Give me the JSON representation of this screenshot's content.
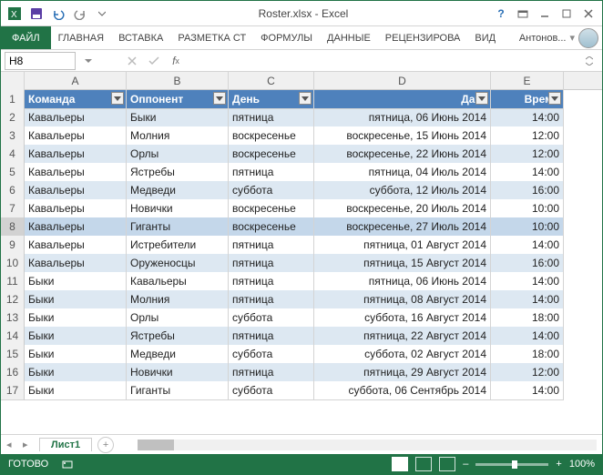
{
  "window": {
    "title": "Roster.xlsx - Excel",
    "user": "Антонов..."
  },
  "ribbon": {
    "file": "ФАЙЛ",
    "tabs": [
      "ГЛАВНАЯ",
      "ВСТАВКА",
      "РАЗМЕТКА СТ",
      "ФОРМУЛЫ",
      "ДАННЫЕ",
      "РЕЦЕНЗИРОВА",
      "ВИД"
    ]
  },
  "namebox": "H8",
  "columns": [
    "A",
    "B",
    "C",
    "D",
    "E"
  ],
  "table": {
    "headers": [
      "Команда",
      "Оппонент",
      "День",
      "Дата",
      "Время"
    ],
    "rows": [
      [
        "Кавальеры",
        "Быки",
        "пятница",
        "пятница, 06 Июнь 2014",
        "14:00"
      ],
      [
        "Кавальеры",
        "Молния",
        "воскресенье",
        "воскресенье, 15 Июнь 2014",
        "12:00"
      ],
      [
        "Кавальеры",
        "Орлы",
        "воскресенье",
        "воскресенье, 22 Июнь 2014",
        "12:00"
      ],
      [
        "Кавальеры",
        "Ястребы",
        "пятница",
        "пятница, 04 Июль 2014",
        "14:00"
      ],
      [
        "Кавальеры",
        "Медведи",
        "суббота",
        "суббота, 12 Июль 2014",
        "16:00"
      ],
      [
        "Кавальеры",
        "Новички",
        "воскресенье",
        "воскресенье, 20 Июль 2014",
        "10:00"
      ],
      [
        "Кавальеры",
        "Гиганты",
        "воскресенье",
        "воскресенье, 27 Июль 2014",
        "10:00"
      ],
      [
        "Кавальеры",
        "Истребители",
        "пятница",
        "пятница, 01 Август 2014",
        "14:00"
      ],
      [
        "Кавальеры",
        "Оруженосцы",
        "пятница",
        "пятница, 15 Август 2014",
        "16:00"
      ],
      [
        "Быки",
        "Кавальеры",
        "пятница",
        "пятница, 06 Июнь 2014",
        "14:00"
      ],
      [
        "Быки",
        "Молния",
        "пятница",
        "пятница, 08 Август 2014",
        "14:00"
      ],
      [
        "Быки",
        "Орлы",
        "суббота",
        "суббота, 16 Август 2014",
        "18:00"
      ],
      [
        "Быки",
        "Ястребы",
        "пятница",
        "пятница, 22 Август 2014",
        "14:00"
      ],
      [
        "Быки",
        "Медведи",
        "суббота",
        "суббота, 02 Август 2014",
        "18:00"
      ],
      [
        "Быки",
        "Новички",
        "пятница",
        "пятница, 29 Август 2014",
        "12:00"
      ],
      [
        "Быки",
        "Гиганты",
        "суббота",
        "суббота, 06 Сентябрь 2014",
        "14:00"
      ]
    ]
  },
  "selected_row": 8,
  "sheet_tab": "Лист1",
  "status": {
    "ready": "ГОТОВО",
    "zoom": "100%"
  }
}
